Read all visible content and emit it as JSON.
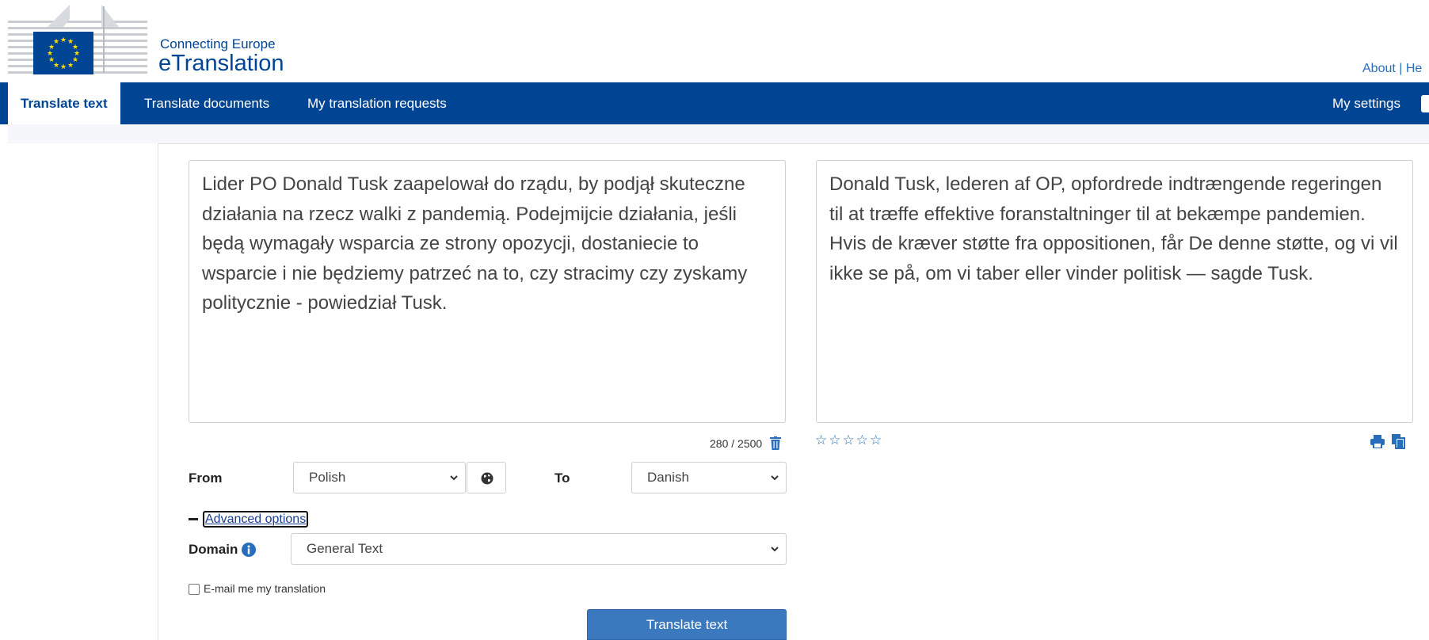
{
  "header": {
    "brand_top": "Connecting Europe",
    "brand_main": "eTranslation",
    "top_links": [
      "About",
      "He"
    ],
    "top_link_separator": "|"
  },
  "nav": {
    "items": [
      {
        "label": "Translate text",
        "active": true
      },
      {
        "label": "Translate documents",
        "active": false
      },
      {
        "label": "My translation requests",
        "active": false
      }
    ],
    "settings_label": "My settings"
  },
  "source": {
    "text": "Lider PO Donald Tusk zaapelował do rządu, by podjął skuteczne działania na rzecz walki z pandemią. Podejmijcie działania, jeśli będą wymagały wsparcia ze strony opozycji, dostaniecie to wsparcie i nie będziemy patrzeć na to, czy stracimy czy zyskamy politycznie - powiedział Tusk.",
    "char_count": "280 / 2500"
  },
  "target": {
    "text": "Donald Tusk, lederen af OP, opfordrede indtrængende regeringen til at træffe effektive foranstaltninger til at bekæmpe pandemien. Hvis de kræver støtte fra oppositionen, får De denne støtte, og vi vil ikke se på, om vi taber eller vinder politisk — sagde Tusk.",
    "rating_stars": "☆☆☆☆☆"
  },
  "options": {
    "from_label": "From",
    "from_value": "Polish",
    "to_label": "To",
    "to_value": "Danish",
    "advanced_label": "Advanced options",
    "domain_label": "Domain",
    "domain_value": "General Text",
    "email_label": "E-mail me my translation",
    "email_checked": false
  },
  "actions": {
    "translate_label": "Translate text"
  },
  "colors": {
    "brand_blue": "#004494",
    "button_blue": "#3a79bd",
    "link_blue": "#2a6ebb",
    "eu_yellow": "#ffdd00"
  },
  "icons": [
    "eu-flag-icon",
    "trash-icon",
    "star-icon",
    "print-icon",
    "copy-icon",
    "globe-icon",
    "info-icon",
    "chevron-down-icon"
  ]
}
